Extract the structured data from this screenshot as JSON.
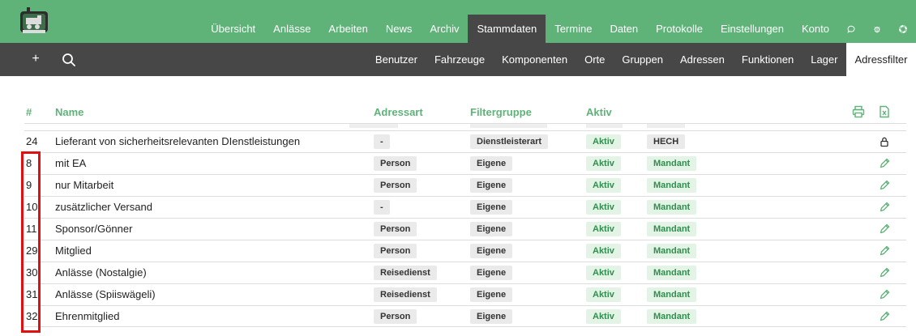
{
  "topnav": {
    "items": [
      "Übersicht",
      "Anlässe",
      "Arbeiten",
      "News",
      "Archiv",
      "Stammdaten",
      "Termine",
      "Daten",
      "Protokolle",
      "Einstellungen",
      "Konto"
    ],
    "active": "Stammdaten",
    "icons": [
      "chat-icon",
      "bug-icon",
      "lifebuoy-icon"
    ]
  },
  "subnav": {
    "items": [
      "Benutzer",
      "Fahrzeuge",
      "Komponenten",
      "Orte",
      "Gruppen",
      "Adressen",
      "Funktionen",
      "Lager",
      "Adressfilter"
    ],
    "active": "Adressfilter"
  },
  "table": {
    "headers": {
      "id": "#",
      "name": "Name",
      "adressart": "Adressart",
      "filtergruppe": "Filtergruppe",
      "aktiv": "Aktiv"
    },
    "rows": [
      {
        "id": "24",
        "name": "Lieferant von sicherheitsrelevanten DIenstleistungen",
        "adressart": "-",
        "filtergruppe": "Dienstleisterart",
        "aktiv": "Aktiv",
        "extra": "HECH",
        "action": "lock"
      },
      {
        "id": "8",
        "name": "mit EA",
        "adressart": "Person",
        "filtergruppe": "Eigene",
        "aktiv": "Aktiv",
        "extra": "Mandant",
        "action": "edit"
      },
      {
        "id": "9",
        "name": "nur Mitarbeit",
        "adressart": "Person",
        "filtergruppe": "Eigene",
        "aktiv": "Aktiv",
        "extra": "Mandant",
        "action": "edit"
      },
      {
        "id": "10",
        "name": "zusätzlicher Versand",
        "adressart": "-",
        "filtergruppe": "Eigene",
        "aktiv": "Aktiv",
        "extra": "Mandant",
        "action": "edit"
      },
      {
        "id": "11",
        "name": "Sponsor/Gönner",
        "adressart": "Person",
        "filtergruppe": "Eigene",
        "aktiv": "Aktiv",
        "extra": "Mandant",
        "action": "edit"
      },
      {
        "id": "29",
        "name": "Mitglied",
        "adressart": "Person",
        "filtergruppe": "Eigene",
        "aktiv": "Aktiv",
        "extra": "Mandant",
        "action": "edit"
      },
      {
        "id": "30",
        "name": "Anlässe (Nostalgie)",
        "adressart": "Reisedienst",
        "filtergruppe": "Eigene",
        "aktiv": "Aktiv",
        "extra": "Mandant",
        "action": "edit"
      },
      {
        "id": "31",
        "name": "Anlässe (Spiiswägeli)",
        "adressart": "Reisedienst",
        "filtergruppe": "Eigene",
        "aktiv": "Aktiv",
        "extra": "Mandant",
        "action": "edit"
      },
      {
        "id": "32",
        "name": "Ehrenmitglied",
        "adressart": "Person",
        "filtergruppe": "Eigene",
        "aktiv": "Aktiv",
        "extra": "Mandant",
        "action": "edit"
      }
    ]
  },
  "colors": {
    "brand": "#5fb278",
    "dark": "#474747",
    "highlight": "#e01010"
  }
}
